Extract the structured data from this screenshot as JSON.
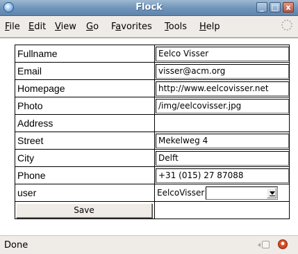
{
  "window": {
    "title": "Flock",
    "controls": {
      "minimize": "_",
      "maximize": "□",
      "close": "x"
    }
  },
  "menubar": {
    "items": [
      {
        "label": "File",
        "mnemonic": "F",
        "rest": "ile"
      },
      {
        "label": "Edit",
        "mnemonic": "E",
        "rest": "dit"
      },
      {
        "label": "View",
        "mnemonic": "V",
        "rest": "iew"
      },
      {
        "label": "Go",
        "mnemonic": "G",
        "rest": "o"
      },
      {
        "label": "Favorites",
        "pre": "F",
        "mnemonic": "a",
        "rest": "vorites"
      },
      {
        "label": "Tools",
        "mnemonic": "T",
        "rest": "ools"
      },
      {
        "label": "Help",
        "mnemonic": "H",
        "rest": "elp"
      }
    ]
  },
  "form": {
    "rows": [
      {
        "label": "Fullname",
        "value": "Eelco Visser"
      },
      {
        "label": "Email",
        "value": "visser@acm.org"
      },
      {
        "label": "Homepage",
        "value": "http://www.eelcovisser.net"
      },
      {
        "label": "Photo",
        "value": "/img/eelcovisser.jpg"
      },
      {
        "label": "Address"
      },
      {
        "label": "Street",
        "value": "Mekelweg 4"
      },
      {
        "label": "City",
        "value": "Delft"
      },
      {
        "label": "Phone",
        "value": "+31 (015) 27 87088"
      }
    ],
    "user": {
      "label": "user",
      "value": "EelcoVisser",
      "select_value": ""
    },
    "save_label": "Save"
  },
  "statusbar": {
    "text": "Done"
  },
  "icons": {
    "app": "flock-logo-icon",
    "throbber": "throbber-icon",
    "status_a": "page-info-icon",
    "status_b": "flock-status-icon"
  }
}
